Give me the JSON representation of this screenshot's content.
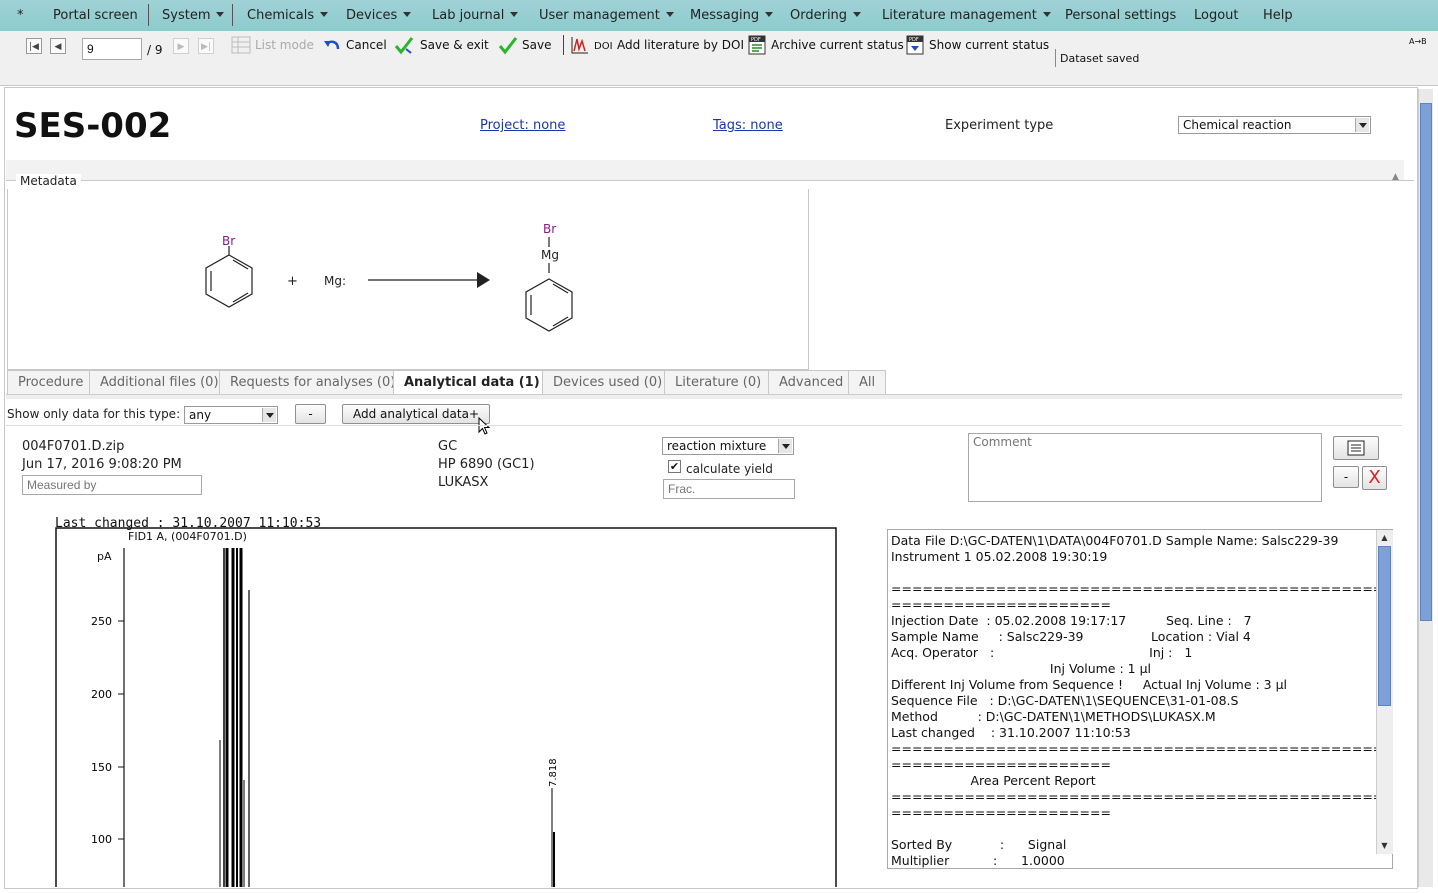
{
  "menu": {
    "star": "*",
    "items": [
      {
        "label": "Portal screen",
        "caret": false
      },
      {
        "label": "System",
        "caret": true
      },
      {
        "label": "Chemicals",
        "caret": true
      },
      {
        "label": "Devices",
        "caret": true
      },
      {
        "label": "Lab journal",
        "caret": true
      },
      {
        "label": "User management",
        "caret": true
      },
      {
        "label": "Messaging",
        "caret": true
      },
      {
        "label": "Ordering",
        "caret": true
      },
      {
        "label": "Literature management",
        "caret": true
      },
      {
        "label": "Personal settings",
        "caret": false
      },
      {
        "label": "Logout",
        "caret": false
      },
      {
        "label": "Help",
        "caret": false
      }
    ]
  },
  "toolbar": {
    "page_value": "9",
    "page_total": "/ 9",
    "list_mode": "List mode",
    "cancel": "Cancel",
    "save_exit": "Save & exit",
    "save": "Save",
    "doi_prefix": "DOI",
    "add_literature": "Add literature by DOI",
    "archive": "Archive current status",
    "show_status": "Show current status",
    "status_message": "Dataset saved",
    "corner_symbol": "A→B"
  },
  "header": {
    "title": "SES-002",
    "project_link": "Project: none",
    "tags_link": "Tags: none",
    "experiment_type_label": "Experiment type",
    "experiment_type_value": "Chemical reaction"
  },
  "metadata_label": "Metadata",
  "reaction": {
    "reactant1_atom": "Br",
    "plus": "+",
    "reactant2": "Mg:",
    "product_atom_top": "Br",
    "product_atom_mid": "Mg"
  },
  "tabs": [
    {
      "label": "Procedure",
      "active": false
    },
    {
      "label": "Additional files (0)",
      "active": false
    },
    {
      "label": "Requests for analyses (0)",
      "active": false
    },
    {
      "label": "Analytical data (1)",
      "active": true
    },
    {
      "label": "Devices used (0)",
      "active": false
    },
    {
      "label": "Literature (0)",
      "active": false
    },
    {
      "label": "Advanced",
      "active": false
    },
    {
      "label": "All",
      "active": false
    }
  ],
  "filter": {
    "label": "Show only data for this type:",
    "value": "any",
    "minus_button": "-",
    "add_button": "Add analytical data+"
  },
  "analysis": {
    "file_name": "004F0701.D.zip",
    "date": "Jun 17, 2016 9:08:20 PM",
    "measured_by_placeholder": "Measured by",
    "method_type": "GC",
    "device": "HP 6890 (GC1)",
    "method_name": "LUKASX",
    "sample_type": "reaction mixture",
    "calculate_yield_label": "calculate yield",
    "calculate_yield_checked": true,
    "frac_placeholder": "Frac.",
    "comment_placeholder": "Comment",
    "minus_button": "-",
    "delete_button": "X"
  },
  "chromatogram": {
    "header_text": "Last changed      : 31.10.2007 11:10:53",
    "trace_label": "FID1 A, (004F0701.D)",
    "y_unit": "pA",
    "y_ticks": [
      "250",
      "200",
      "150",
      "100"
    ],
    "peak_label": "7.818"
  },
  "report_lines": [
    "Data File D:\\GC-DATEN\\1\\DATA\\004F0701.D Sample Name: Salsc229-39",
    "Instrument 1 05.02.2008 19:30:19",
    "",
    "================================================",
    "=====================",
    "Injection Date  : 05.02.2008 19:17:17          Seq. Line :   7",
    "Sample Name     : Salsc229-39                 Location : Vial 4",
    "Acq. Operator   :                                       Inj :   1",
    "                                        Inj Volume : 1 µl",
    "Different Inj Volume from Sequence !     Actual Inj Volume : 3 µl",
    "Sequence File   : D:\\GC-DATEN\\1\\SEQUENCE\\31-01-08.S",
    "Method          : D:\\GC-DATEN\\1\\METHODS\\LUKASX.M",
    "Last changed    : 31.10.2007 11:10:53",
    "================================================",
    "=====================",
    "                    Area Percent Report",
    "================================================",
    "=====================",
    "",
    "Sorted By            :      Signal",
    "Multiplier           :      1.0000"
  ],
  "colors": {
    "menubar": "#8ecacd",
    "link": "#1c35a8",
    "halogen": "#8b1a8b",
    "delete": "#e02020",
    "scroll_thumb": "#7da0d8"
  }
}
